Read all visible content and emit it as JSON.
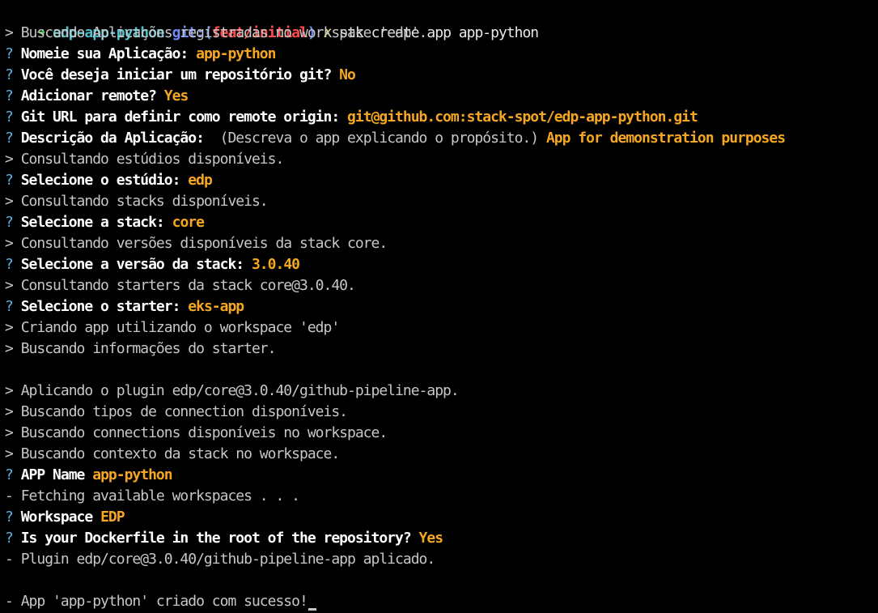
{
  "prompt": {
    "arrow": "➜",
    "directory": "edp-app-python",
    "git_label": "git:(",
    "branch": "feat/initial",
    "git_close": ")",
    "dirty_mark": "✗",
    "command": "stk create app app-python"
  },
  "lines": [
    {
      "prefix": ">",
      "text": "Buscando Aplicações registradas no workspace 'edp'."
    },
    {
      "prefix": "?",
      "question": "Nomeie sua Aplicação:",
      "answer": "app-python"
    },
    {
      "prefix": "?",
      "question": "Você deseja iniciar um repositório git?",
      "answer": "No"
    },
    {
      "prefix": "?",
      "question": "Adicionar remote?",
      "answer": "Yes"
    },
    {
      "prefix": "?",
      "question": "Git URL para definir como remote origin:",
      "answer": "git@github.com:stack-spot/edp-app-python.git"
    },
    {
      "prefix": "?",
      "question": "Descrição da Aplicação:",
      "hint": "(Descreva o app explicando o propósito.)",
      "answer": "App for demonstration purposes"
    },
    {
      "prefix": ">",
      "text": "Consultando estúdios disponíveis."
    },
    {
      "prefix": "?",
      "question": "Selecione o estúdio:",
      "answer": "edp"
    },
    {
      "prefix": ">",
      "text": "Consultando stacks disponíveis."
    },
    {
      "prefix": "?",
      "question": "Selecione a stack:",
      "answer": "core"
    },
    {
      "prefix": ">",
      "text": "Consultando versões disponíveis da stack core."
    },
    {
      "prefix": "?",
      "question": "Selecione a versão da stack:",
      "answer": "3.0.40"
    },
    {
      "prefix": ">",
      "text": "Consultando starters da stack core@3.0.40."
    },
    {
      "prefix": "?",
      "question": "Selecione o starter:",
      "answer": "eks-app"
    },
    {
      "prefix": ">",
      "text": "Criando app utilizando o workspace 'edp'"
    },
    {
      "prefix": ">",
      "text": "Buscando informações do starter."
    },
    {
      "prefix": "",
      "text": ""
    },
    {
      "prefix": ">",
      "text": "Aplicando o plugin edp/core@3.0.40/github-pipeline-app."
    },
    {
      "prefix": ">",
      "text": "Buscando tipos de connection disponíveis."
    },
    {
      "prefix": ">",
      "text": "Buscando connections disponíveis no workspace."
    },
    {
      "prefix": ">",
      "text": "Buscando contexto da stack no workspace."
    },
    {
      "prefix": "?",
      "question": "APP Name",
      "answer": "app-python"
    },
    {
      "prefix": "-",
      "text": "Fetching available workspaces . . ."
    },
    {
      "prefix": "?",
      "question": "Workspace",
      "answer": "EDP"
    },
    {
      "prefix": "?",
      "question": "Is your Dockerfile in the root of the repository?",
      "answer": "Yes"
    },
    {
      "prefix": "-",
      "text": "Plugin edp/core@3.0.40/github-pipeline-app aplicado."
    },
    {
      "prefix": "",
      "text": ""
    },
    {
      "prefix": "-",
      "text": "App 'app-python' criado com sucesso!",
      "cursor": true
    }
  ]
}
